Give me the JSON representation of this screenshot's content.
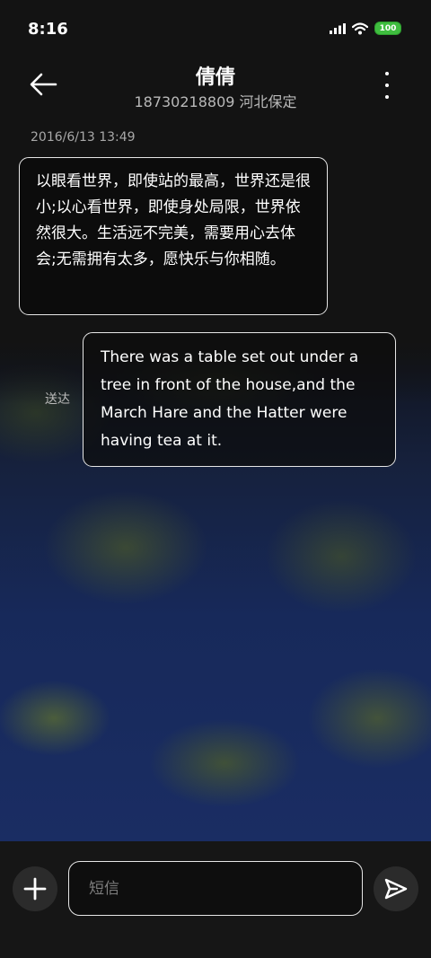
{
  "status_bar": {
    "time": "8:16",
    "battery": "100",
    "icons": [
      "signal-icon",
      "wifi-icon",
      "battery-icon"
    ]
  },
  "header": {
    "contact_name": "倩倩",
    "contact_detail": "18730218809 河北保定"
  },
  "conversation": {
    "timestamp": "2016/6/13 13:49",
    "incoming_message": "以眼看世界，即使站的最高，世界还是很小;以心看世界，即使身处局限，世界依然很大。生活远不完美，需要用心去体会;无需拥有太多，愿快乐与你相随。",
    "outgoing_message": "There was a table set out under a tree in front of the house,and the March Hare and the Hatter were having tea at it.",
    "outgoing_status": "送达"
  },
  "composer": {
    "placeholder": "短信",
    "value": ""
  },
  "colors": {
    "battery": "#3fbd3f",
    "background": "#131313",
    "bubble_border": "#e6e6e6"
  }
}
